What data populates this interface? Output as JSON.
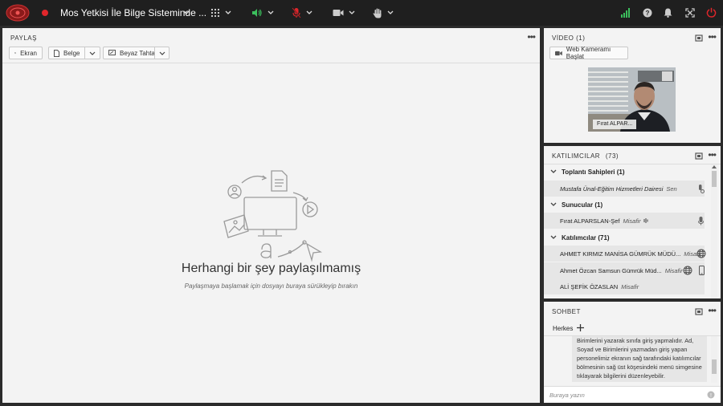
{
  "window": {
    "meeting_title": "Mos Yetkisi İle Bilge Sisteminde ...",
    "accent_color": "#e0262b",
    "icons": [
      "emblem-logo",
      "record-dot-icon",
      "grid-apps-icon",
      "speaker-icon",
      "mic-muted-icon",
      "camera-icon",
      "raise-hand-icon",
      "signal-icon",
      "help-icon",
      "bell-icon",
      "fullscreen-icon",
      "power-icon"
    ]
  },
  "share": {
    "header": "PAYLAŞ",
    "buttons": {
      "screen": "Ekran",
      "document": "Belge",
      "whiteboard": "Beyaz Tahta"
    },
    "empty_title": "Herhangi bir şey paylaşılmamış",
    "empty_hint": "Paylaşmaya başlamak için dosyayı buraya sürükleyip bırakın"
  },
  "video": {
    "header": "VİDEO (1)",
    "start_webcam": "Web Kameramı Başlat",
    "tile_name": "Fırat ALPAR..."
  },
  "participants": {
    "header": "KATILIMCILAR",
    "count": "(73)",
    "groups": {
      "hosts": {
        "label": "Toplantı Sahipleri (1)"
      },
      "presenters": {
        "label": "Sunucular (1)"
      },
      "attendees": {
        "label": "Katılımcılar (71)"
      }
    },
    "host": {
      "name": "Mustafa Ünal-Eğitim Hizmetleri Dairesi",
      "role": "Sen"
    },
    "presenter": {
      "name": "Fırat ALPARSLAN-Şef",
      "role": "Misafir"
    },
    "attendees_list": [
      {
        "name": "AHMET KIRMIZ MANİSA GÜMRÜK MÜDÜ...",
        "role": "Misafir"
      },
      {
        "name": "Ahmet Özcan Samsun Gümrük Müd...",
        "role": "Misafir"
      },
      {
        "name": "ALİ ŞEFİK ÖZASLAN",
        "role": "Misafir"
      }
    ]
  },
  "chat": {
    "header": "SOHBET",
    "tab_everyone": "Herkes",
    "message": "Birimlerini yazarak sınıfa giriş yapmalıdır. Ad, Soyad ve Birimlerini yazmadan giriş yapan personelimiz ekranın sağ tarafındaki katılımcılar bölmesinin sağ üst köşesindeki menü simgesine tıklayarak bilgilerini düzenleyebilir.",
    "input_placeholder": "Buraya yazın"
  }
}
